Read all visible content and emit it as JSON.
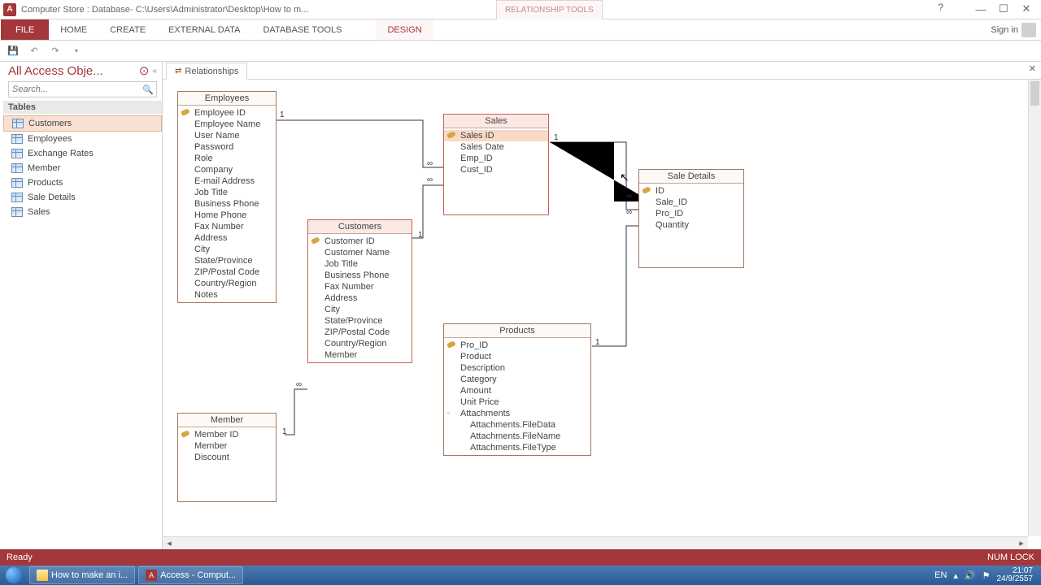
{
  "titlebar": {
    "app_icon_letter": "A",
    "title": "Computer Store : Database- C:\\Users\\Administrator\\Desktop\\How to m...",
    "context_tab": "RELATIONSHIP TOOLS",
    "help": "?"
  },
  "ribbon": {
    "file": "FILE",
    "tabs": [
      "HOME",
      "CREATE",
      "EXTERNAL DATA",
      "DATABASE TOOLS"
    ],
    "ctx_tab": "DESIGN",
    "signin": "Sign in"
  },
  "nav": {
    "title": "All Access Obje...",
    "search_placeholder": "Search...",
    "group": "Tables",
    "items": [
      "Customers",
      "Employees",
      "Exchange Rates",
      "Member",
      "Products",
      "Sale Details",
      "Sales"
    ],
    "selected_index": 0
  },
  "doc_tab": {
    "label": "Relationships"
  },
  "tables": {
    "employees": {
      "title": "Employees",
      "fields": [
        "Employee ID",
        "Employee Name",
        "User Name",
        "Password",
        "Role",
        "Company",
        "E-mail Address",
        "Job Title",
        "Business Phone",
        "Home Phone",
        "Fax Number",
        "Address",
        "City",
        "State/Province",
        "ZIP/Postal Code",
        "Country/Region",
        "Notes"
      ],
      "pk": [
        0
      ]
    },
    "customers": {
      "title": "Customers",
      "fields": [
        "Customer ID",
        "Customer Name",
        "Job Title",
        "Business Phone",
        "Fax Number",
        "Address",
        "City",
        "State/Province",
        "ZIP/Postal Code",
        "Country/Region",
        "Member"
      ],
      "pk": [
        0
      ]
    },
    "member": {
      "title": "Member",
      "fields": [
        "Member ID",
        "Member",
        "Discount"
      ],
      "pk": [
        0
      ]
    },
    "sales": {
      "title": "Sales",
      "fields": [
        "Sales ID",
        "Sales Date",
        "Emp_ID",
        "Cust_ID"
      ],
      "pk": [
        0
      ],
      "selected_field": 0
    },
    "products": {
      "title": "Products",
      "fields": [
        "Pro_ID",
        "Product",
        "Description",
        "Category",
        "Amount",
        "Unit Price",
        "Attachments",
        "Attachments.FileData",
        "Attachments.FileName",
        "Attachments.FileType"
      ],
      "pk": [
        0
      ]
    },
    "sale_details": {
      "title": "Sale Details",
      "fields": [
        "ID",
        "Sale_ID",
        "Pro_ID",
        "Quantity"
      ],
      "pk": [
        0
      ]
    }
  },
  "status": {
    "left": "Ready",
    "right": "NUM LOCK"
  },
  "taskbar": {
    "buttons": [
      {
        "label": "How to make an i..."
      },
      {
        "label": "Access - Comput..."
      }
    ],
    "lang": "EN",
    "time": "21:07",
    "date": "24/9/2557"
  },
  "rel_labels": {
    "one": "1",
    "inf": "∞"
  }
}
